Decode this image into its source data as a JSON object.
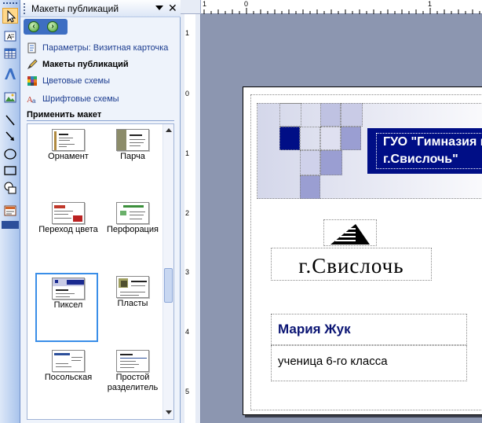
{
  "task_pane": {
    "title": "Макеты публикаций",
    "links": [
      {
        "label": "Параметры: Визитная карточка",
        "icon": "publication-options-icon"
      },
      {
        "label": "Макеты публикаций",
        "icon": "publication-designs-icon"
      },
      {
        "label": "Цветовые схемы",
        "icon": "color-schemes-icon"
      },
      {
        "label": "Шрифтовые схемы",
        "icon": "font-schemes-icon"
      }
    ],
    "apply_label": "Применить макет",
    "designs": [
      {
        "label": "Орнамент"
      },
      {
        "label": "Парча"
      },
      {
        "label": "Переход цвета"
      },
      {
        "label": "Перфорация"
      },
      {
        "label": "Пиксел",
        "selected": true
      },
      {
        "label": "Пласты"
      },
      {
        "label": "Посольская"
      },
      {
        "label": "Простой разделитель"
      }
    ]
  },
  "ruler": {
    "top_numbers": [
      "1",
      "0",
      "1"
    ],
    "left_numbers": [
      "1",
      "0",
      "1",
      "2",
      "3",
      "4",
      "5"
    ]
  },
  "card": {
    "title": "ГУО \"Гимназия г.\nг.Свислочь\"",
    "logo_text": "г.Свислочь",
    "name": "Мария Жук",
    "role": "ученица 6-го класса"
  },
  "colors": {
    "title_background": "#000e86",
    "name_color": "#0a1473",
    "accent_pixel": "#2a2f8a",
    "selection": "#3a8ee8"
  },
  "toolbar_tools": [
    "select-arrow-icon",
    "text-box-icon",
    "table-icon",
    "wordart-icon",
    "picture-icon",
    "line-icon",
    "arrow-icon",
    "oval-icon",
    "rectangle-icon",
    "autoshapes-icon",
    "design-gallery-icon"
  ]
}
